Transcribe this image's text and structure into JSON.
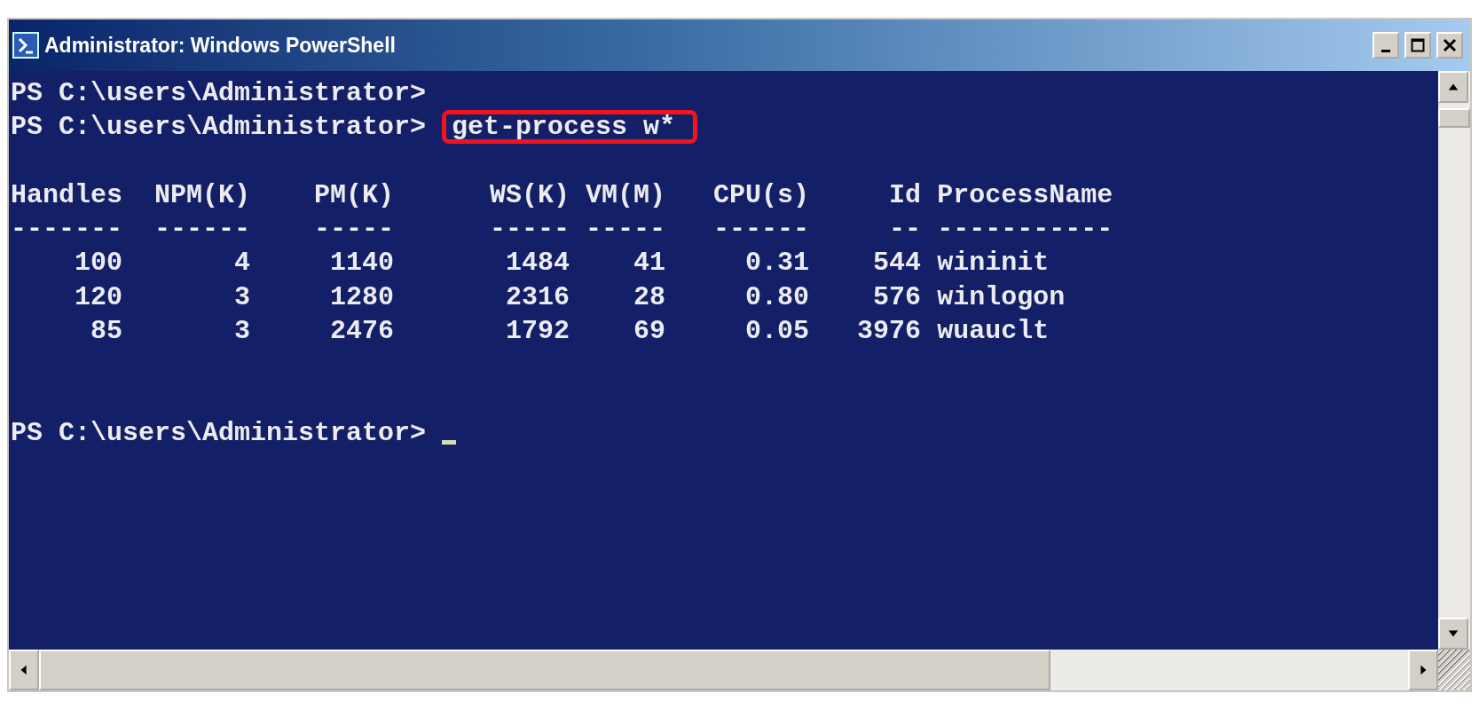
{
  "window": {
    "title": "Administrator: Windows PowerShell"
  },
  "console": {
    "before": [
      {
        "prompt": "PS C:\\users\\Administrator>"
      },
      {
        "prompt": "PS C:\\users\\Administrator>",
        "command": "get-process w*",
        "highlighted": true
      }
    ],
    "table": {
      "columns": [
        {
          "name": "Handles",
          "rule": "-------"
        },
        {
          "name": "NPM(K)",
          "rule": "------"
        },
        {
          "name": "PM(K)",
          "rule": "-----"
        },
        {
          "name": "WS(K)",
          "rule": "-----"
        },
        {
          "name": "VM(M)",
          "rule": "-----"
        },
        {
          "name": "CPU(s)",
          "rule": "------"
        },
        {
          "name": "Id",
          "rule": "--"
        },
        {
          "name": "ProcessName",
          "rule": "-----------"
        }
      ],
      "rows": [
        [
          "100",
          "4",
          "1140",
          "1484",
          "41",
          "0.31",
          "544",
          "wininit"
        ],
        [
          "120",
          "3",
          "1280",
          "2316",
          "28",
          "0.80",
          "576",
          "winlogon"
        ],
        [
          "85",
          "3",
          "2476",
          "1792",
          "69",
          "0.05",
          "3976",
          "wuauclt"
        ]
      ]
    },
    "after": [
      {
        "prompt": "PS C:\\users\\Administrator>"
      }
    ]
  }
}
